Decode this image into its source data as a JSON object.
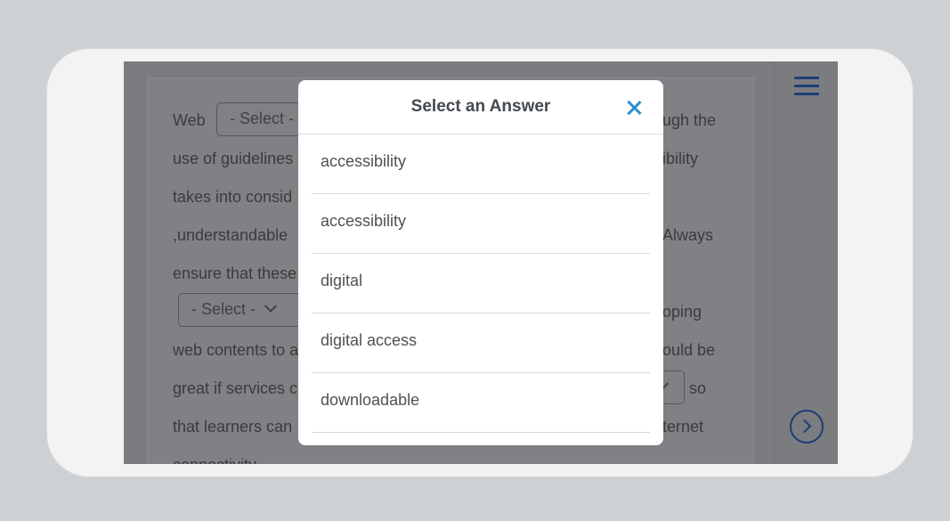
{
  "passage": {
    "lines": [
      "Web",
      "use of guidelines",
      "takes into consid",
      ",understandable",
      "ensure that these",
      "web contents to a",
      "great if services c",
      "that learners can",
      "connectivity"
    ],
    "right_fragments": [
      "ugh the",
      "ibility",
      "Always",
      "oping",
      "ould be",
      "so",
      "ternet"
    ],
    "select_placeholder": "- Select -"
  },
  "modal": {
    "title": "Select an Answer",
    "options": [
      "accessibility",
      "accessibility",
      "digital",
      "digital access",
      "downloadable"
    ]
  },
  "icons": {
    "close": "close-icon",
    "menu": "hamburger-menu-icon",
    "next": "next-arrow-icon"
  },
  "colors": {
    "accent": "#2a8fd0",
    "nav_icon": "#1c3e73"
  }
}
